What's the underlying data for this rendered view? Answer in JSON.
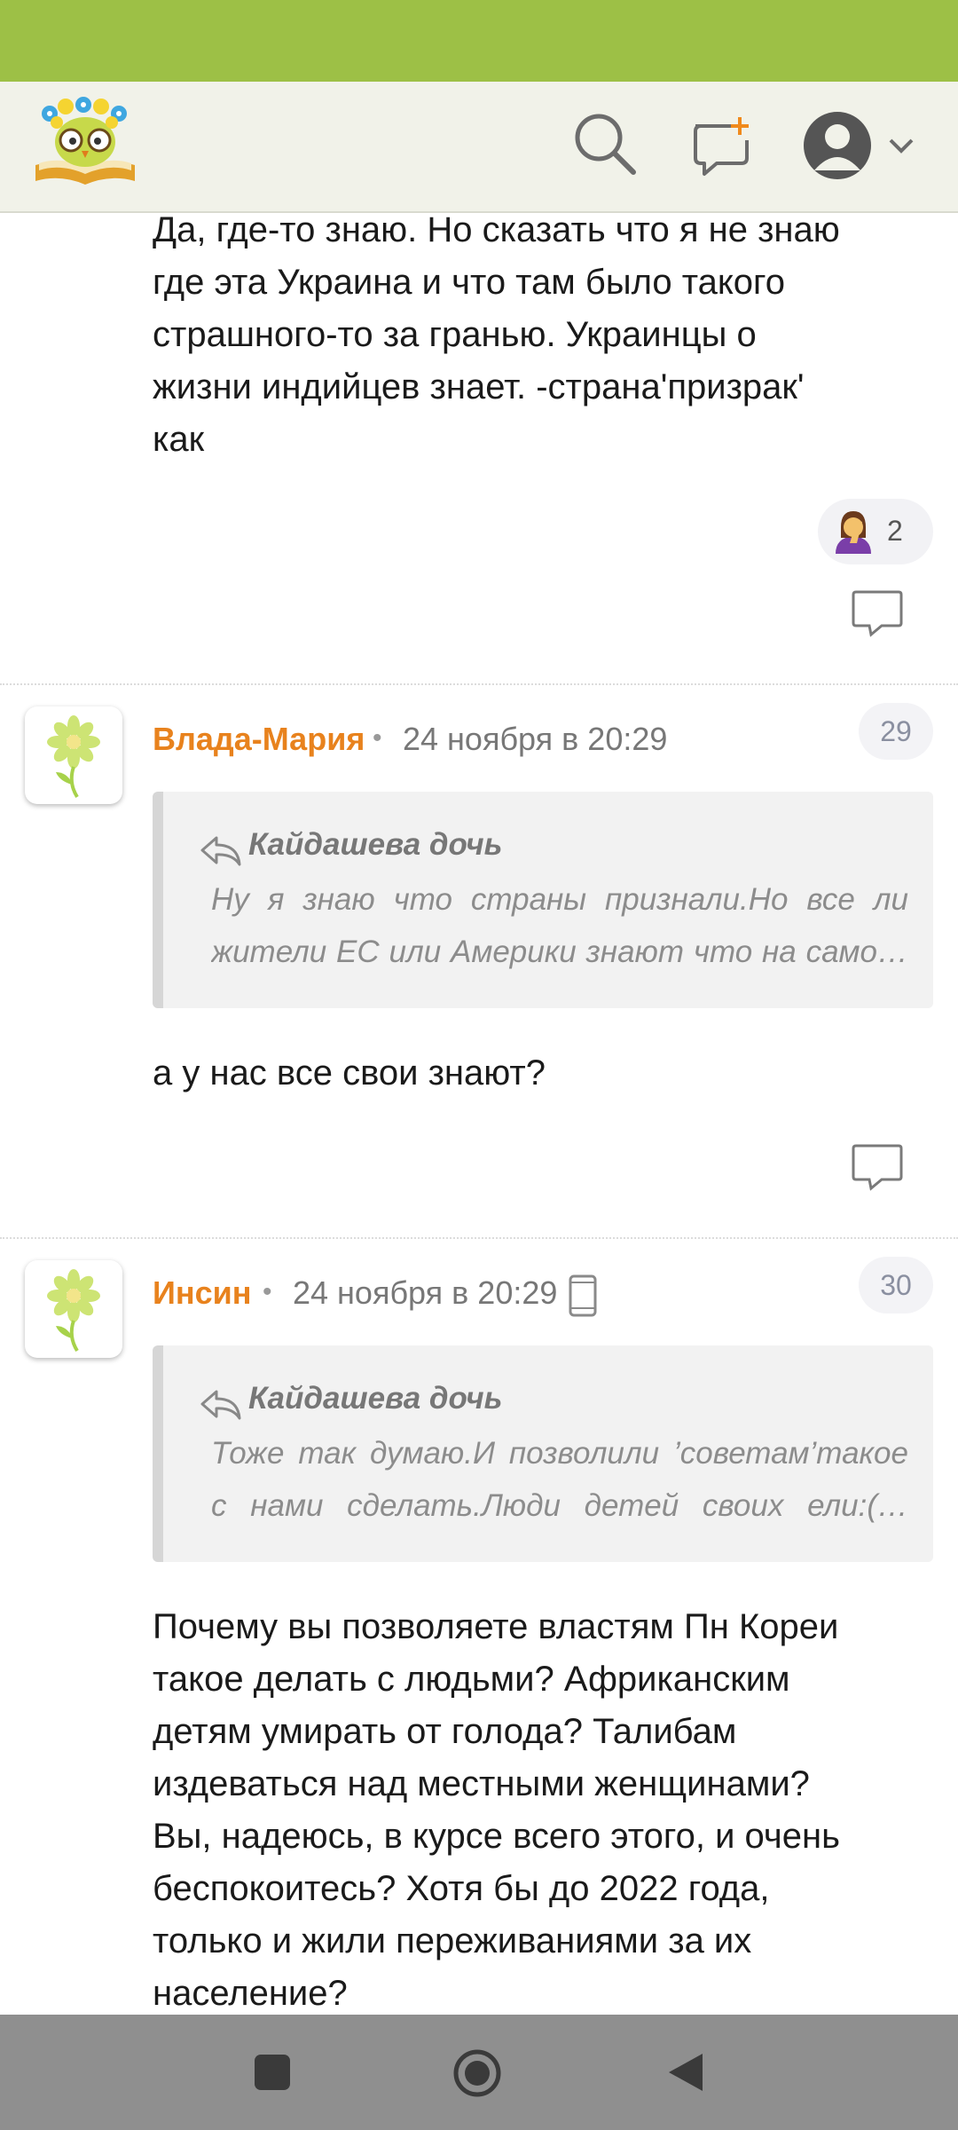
{
  "header": {
    "logo": "owl-reading-book-logo",
    "icons": [
      "search-icon",
      "new-post-icon",
      "account-icon",
      "chevron-down-icon"
    ]
  },
  "first_comment": {
    "text_lines": [
      "Да, где-то знаю. Но сказать что я не знаю",
      "где эта Украина и что там было такого",
      "страшного-то за гранью. Украинцы о",
      "жизни индийцев знает. -страна'призрак'",
      "как"
    ],
    "reaction": {
      "icon": "facepalm-emoji",
      "count": "2"
    }
  },
  "comments": [
    {
      "author": "Влада-Мария",
      "timestamp": "24 ноября в 20:29",
      "number": "29",
      "quote": {
        "author": "Кайдашева дочь",
        "lines": [
          "Ну я знаю что страны признали.Но все ли",
          "жители ЕС или Америки знают что на само…"
        ]
      },
      "text_lines": [
        "а у нас все свои знают?"
      ]
    },
    {
      "author": "Инсин",
      "timestamp": "24 ноября в 20:29",
      "number": "30",
      "device": "phone-icon",
      "quote": {
        "author": "Кайдашева дочь",
        "lines": [
          "Тоже так думаю.И позволили ’советам’такое",
          "с нами сделать.Люди детей своих ели:(…"
        ]
      },
      "text_lines": [
        "Почему вы позволяете властям Пн Кореи",
        "такое делать с людьми? Африканским",
        "детям умирать от голода? Талибам",
        "издеваться над местными женщинами?",
        "Вы, надеюсь, в курсе всего этого, и очень",
        "беспокоитесь? Хотя бы до 2022 года,",
        "только и жили переживаниями за их",
        "население?"
      ]
    }
  ],
  "separator": "•",
  "colors": {
    "status_bar": "#9dc046",
    "header_bg": "#f1f2e9",
    "author": "#e8821d",
    "nav_bar": "#8f8f8f"
  }
}
